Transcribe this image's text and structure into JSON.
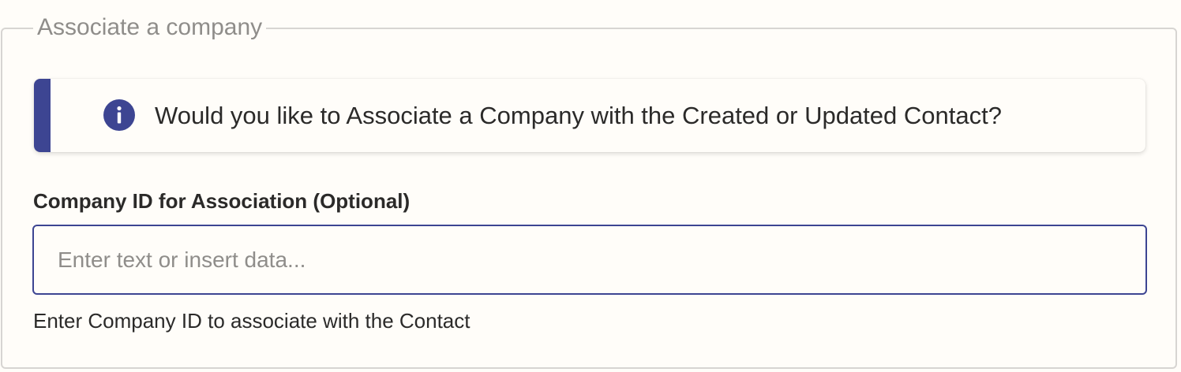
{
  "section": {
    "legend": "Associate a company"
  },
  "alert": {
    "icon": "info-icon",
    "message": "Would you like to Associate a Company with the Created or Updated Contact?",
    "accent_color": "#3d4592"
  },
  "field": {
    "label": "Company ID for Association (Optional)",
    "value": "",
    "placeholder": "Enter text or insert data...",
    "help_text": "Enter Company ID to associate with the Contact"
  }
}
